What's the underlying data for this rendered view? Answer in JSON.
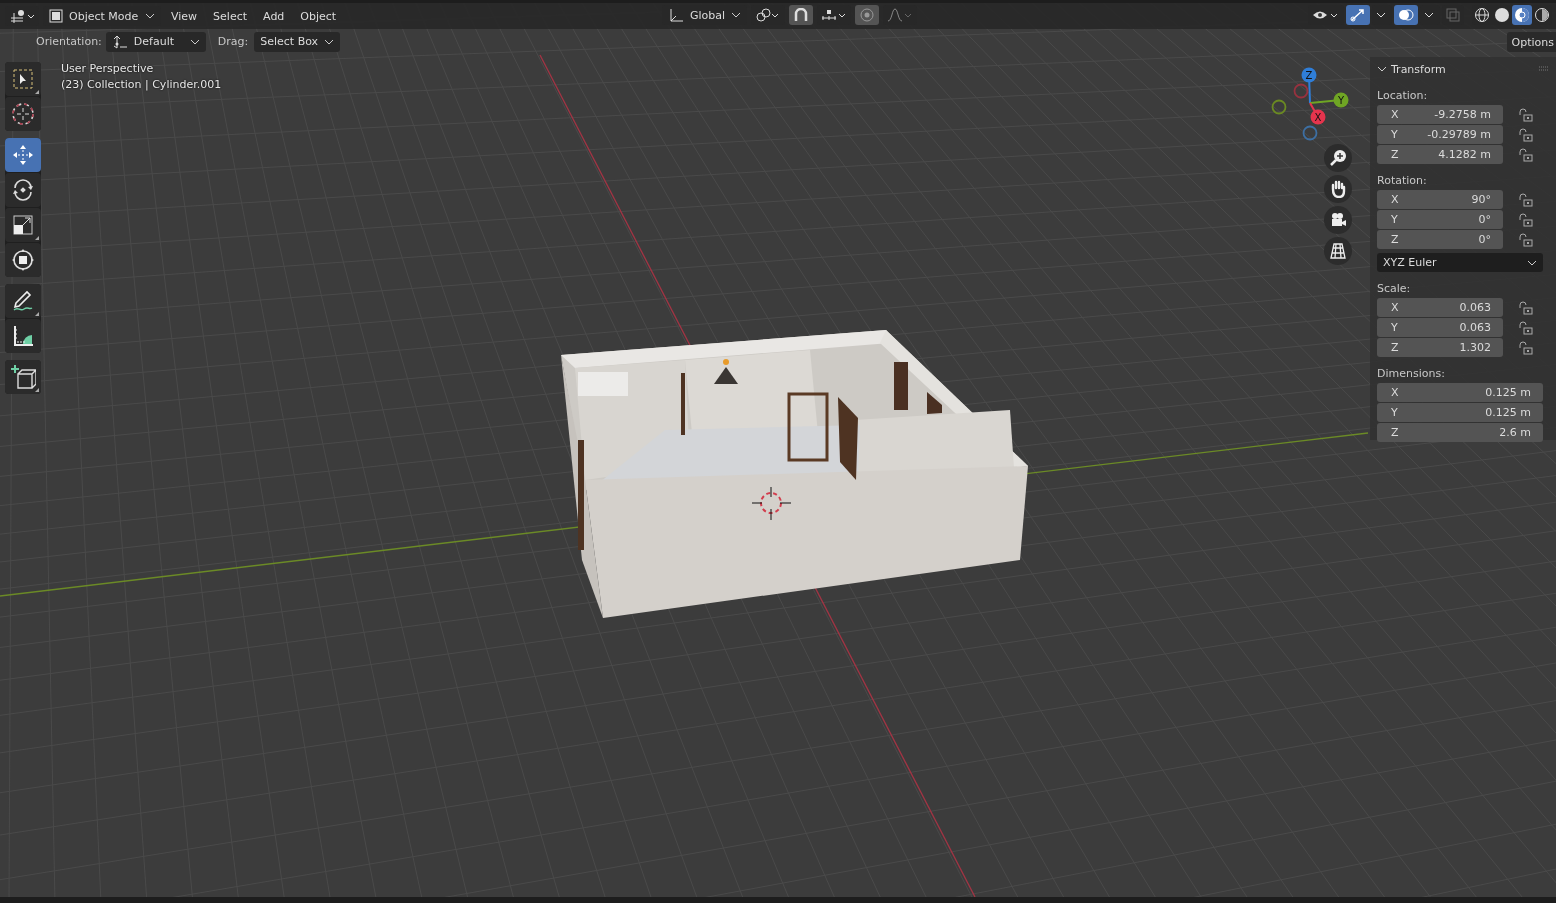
{
  "header": {
    "mode": "Object Mode",
    "menus": [
      "View",
      "Select",
      "Add",
      "Object"
    ],
    "transform_orientation": "Global",
    "snap": {
      "on": false
    },
    "proportional_editing": {
      "on": false
    },
    "gizmos": {
      "on": true
    },
    "overlays": {
      "on": true
    },
    "xray": {
      "on": false
    },
    "shading": [
      {
        "kind": "wireframe",
        "selected": false
      },
      {
        "kind": "solid",
        "selected": false
      },
      {
        "kind": "material",
        "selected": true
      },
      {
        "kind": "rendered",
        "selected": false
      }
    ]
  },
  "tool_settings": {
    "orientation_label": "Orientation:",
    "orientation": "Default",
    "drag_label": "Drag:",
    "drag": "Select Box",
    "options": "Options"
  },
  "viewport_info": [
    "User Perspective",
    "(23) Collection | Cylinder.001"
  ],
  "tool_groups": [
    {
      "tools": [
        {
          "kind": "select_box",
          "selected": false,
          "has_variants": true
        },
        {
          "kind": "cursor",
          "selected": false,
          "has_variants": false
        }
      ]
    },
    {
      "tools": [
        {
          "kind": "move",
          "selected": true,
          "has_variants": false
        },
        {
          "kind": "rotate",
          "selected": false,
          "has_variants": false
        },
        {
          "kind": "scale",
          "selected": false,
          "has_variants": true
        },
        {
          "kind": "transform",
          "selected": false,
          "has_variants": false
        }
      ]
    },
    {
      "tools": [
        {
          "kind": "annotate",
          "selected": false,
          "has_variants": true
        },
        {
          "kind": "measure",
          "selected": false,
          "has_variants": false
        }
      ]
    },
    {
      "tools": [
        {
          "kind": "add_cube",
          "selected": false,
          "has_variants": true
        }
      ]
    }
  ],
  "gizmo_axes": [
    {
      "kind": "negative",
      "color": "#3d6fa3"
    },
    {
      "kind": "negative",
      "color": "#98323f"
    },
    {
      "kind": "negative",
      "color": "#6b8a22"
    },
    {
      "kind": "positive",
      "label": "Z",
      "color": "#2f7ed8"
    },
    {
      "kind": "positive",
      "label": "Y",
      "color": "#6fa524"
    },
    {
      "kind": "positive",
      "label": "X",
      "color": "#e5344d"
    }
  ],
  "nav_buttons": [
    {
      "kind": "zoom"
    },
    {
      "kind": "pan"
    },
    {
      "kind": "camera"
    },
    {
      "kind": "ortho"
    }
  ],
  "sidebar": {
    "panel": {
      "title": "Transform",
      "expanded": true
    },
    "sections": [
      {
        "label": "Location:",
        "fields": [
          {
            "axis": "X",
            "value": "-9.2758 m",
            "locked": false
          },
          {
            "axis": "Y",
            "value": "-0.29789 m",
            "locked": false
          },
          {
            "axis": "Z",
            "value": "4.1282 m",
            "locked": false
          }
        ]
      },
      {
        "label": "Rotation:",
        "fields": [
          {
            "axis": "X",
            "value": "90°",
            "locked": false
          },
          {
            "axis": "Y",
            "value": "0°",
            "locked": false
          },
          {
            "axis": "Z",
            "value": "0°",
            "locked": false
          }
        ],
        "mode": "XYZ Euler"
      },
      {
        "label": "Scale:",
        "fields": [
          {
            "axis": "X",
            "value": "0.063",
            "locked": false
          },
          {
            "axis": "Y",
            "value": "0.063",
            "locked": false
          },
          {
            "axis": "Z",
            "value": "1.302",
            "locked": false
          }
        ]
      },
      {
        "label": "Dimensions:",
        "fields": [
          {
            "axis": "X",
            "value": "0.125 m"
          },
          {
            "axis": "Y",
            "value": "0.125 m"
          },
          {
            "axis": "Z",
            "value": "2.6 m"
          }
        ]
      }
    ]
  }
}
